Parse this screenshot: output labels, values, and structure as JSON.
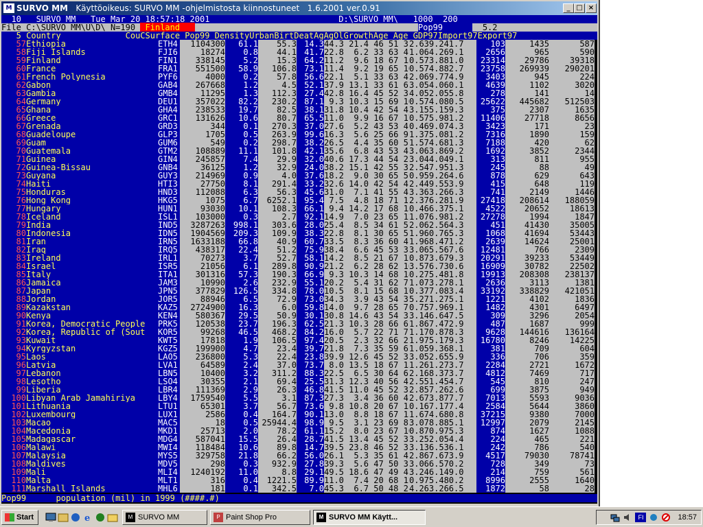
{
  "window": {
    "title": "SURVO MM",
    "title_rest": "   Käyttöoikeus: SURVO MM -ohjelmistosta kiinnostuneet   1.6.2001 ver.0.91",
    "minimize_label": "_",
    "maximize_label": "□",
    "close_label": "×"
  },
  "console": {
    "line0": "  10   SURVO MM   Tue Mar 20 18:57:18 2001                          D:\\SURVO_MM\\   1000  200",
    "line1_pre": "File C:\\SURVO_MM\\U\\D\\ N=190 ",
    "line1_hl": " Finland   ",
    "line1_mid": "                                             ",
    "line1_hl2": "Pop99      ",
    "line1_val": "  5.2    ",
    "header": "   5 Country             CouCSurface Pop99 DensityUrbanBirtDeatAgAgOlGrowthAge_Age_GDP97Import97Export97",
    "status_line": "Pop99      population (mil) in 1999 (####.#)"
  },
  "rows": [
    {
      "n": "57",
      "name": "Ethiopia",
      "code": "ETH4",
      "sur": "1104300",
      "pop": "61.1",
      "den": "55.3",
      "urb": "14.3",
      "misc": "44.3 21.4 46 51 3",
      "grw": "2.639.241.7",
      "gdp": "103",
      "imp": "1435",
      "exp": "587"
    },
    {
      "n": "58",
      "name": "Fiji Islands",
      "code": "FJI6",
      "sur": "18274",
      "pop": "0.8",
      "den": "44.1",
      "urb": "41.7",
      "misc": "22.8  6.2 33 63 4",
      "grw": "1.064.269.1",
      "gdp": "2656",
      "imp": "965",
      "exp": "590"
    },
    {
      "n": "59",
      "name": "Finland",
      "code": "FIN1",
      "sur": "338145",
      "pop": "5.2",
      "den": "15.3",
      "urb": "64.2",
      "misc": "11.2  9.6 18 67 15",
      "grw": "0.573.881.0",
      "gdp": "23314",
      "imp": "29786",
      "exp": "39318"
    },
    {
      "n": "60",
      "name": "France",
      "code": "FRA1",
      "sur": "551500",
      "pop": "58.9",
      "den": "106.8",
      "urb": "73.1",
      "misc": "11.4  9.2 19 65 16",
      "grw": "0.574.882.7",
      "gdp": "23758",
      "imp": "269939",
      "exp": "290201"
    },
    {
      "n": "61",
      "name": "French Polynesia",
      "code": "PYF6",
      "sur": "4000",
      "pop": "0.2",
      "den": "57.8",
      "urb": "56.6",
      "misc": "22.1  5.1 33 63 4",
      "grw": "2.069.774.9",
      "gdp": "3403",
      "imp": "945",
      "exp": "224"
    },
    {
      "n": "62",
      "name": "Gabon",
      "code": "GAB4",
      "sur": "267668",
      "pop": "1.2",
      "den": "4.5",
      "urb": "52.1",
      "misc": "37.9 13.1 33 61 6",
      "grw": "3.054.060.1",
      "gdp": "4639",
      "imp": "1102",
      "exp": "3020"
    },
    {
      "n": "63",
      "name": "Gambia",
      "code": "GMB4",
      "sur": "11295",
      "pop": "1.3",
      "den": "112.3",
      "urb": "27.4",
      "misc": "42.8 16.4 45 52 3",
      "grw": "4.052.055.8",
      "gdp": "278",
      "imp": "141",
      "exp": "14"
    },
    {
      "n": "64",
      "name": "Germany",
      "code": "DEU1",
      "sur": "357022",
      "pop": "82.2",
      "den": "230.2",
      "urb": "87.1",
      "misc": " 9.3 10.3 15 69 16",
      "grw": "0.574.080.5",
      "gdp": "25622",
      "imp": "445682",
      "exp": "512503"
    },
    {
      "n": "65",
      "name": "Ghana",
      "code": "GHA4",
      "sur": "238533",
      "pop": "19.7",
      "den": "82.5",
      "urb": "38.1",
      "misc": "31.8 10.4 42 54 4",
      "grw": "3.155.159.3",
      "gdp": "375",
      "imp": "2307",
      "exp": "1635"
    },
    {
      "n": "66",
      "name": "Greece",
      "code": "GRC1",
      "sur": "131626",
      "pop": "10.6",
      "den": "80.7",
      "urb": "65.5",
      "misc": "11.0  9.9 16 67 17",
      "grw": "0.575.981.2",
      "gdp": "11406",
      "imp": "27718",
      "exp": "8656"
    },
    {
      "n": "67",
      "name": "Grenada",
      "code": "GRD3",
      "sur": "344",
      "pop": "0.1",
      "den": "270.3",
      "urb": "37.0",
      "misc": "27.6  5.2 43 53 4",
      "grw": "0.469.074.3",
      "gdp": "3423",
      "imp": "171",
      "exp": "23"
    },
    {
      "n": "68",
      "name": "Guadeloupe",
      "code": "GLP3",
      "sur": "1705",
      "pop": "0.5",
      "den": "263.9",
      "urb": "99.6",
      "misc": "16.3  5.6 25 66 9",
      "grw": "1.375.081.2",
      "gdp": "7316",
      "imp": "1890",
      "exp": "159"
    },
    {
      "n": "69",
      "name": "Guam",
      "code": "GUM6",
      "sur": "549",
      "pop": "0.2",
      "den": "298.7",
      "urb": "38.2",
      "misc": "26.5  4.4 35 60 5",
      "grw": "1.574.681.3",
      "gdp": "7188",
      "imp": "420",
      "exp": "62"
    },
    {
      "n": "70",
      "name": "Guatemala",
      "code": "GTM2",
      "sur": "108889",
      "pop": "11.1",
      "den": "101.8",
      "urb": "42.1",
      "misc": "35.6  6.8 43 53 4",
      "grw": "3.063.869.2",
      "gdp": "1692",
      "imp": "3852",
      "exp": "2344"
    },
    {
      "n": "71",
      "name": "Guinea",
      "code": "GIN4",
      "sur": "245857",
      "pop": "7.4",
      "den": "29.9",
      "urb": "32.0",
      "misc": "40.6 17.3 44 54 2",
      "grw": "3.044.049.1",
      "gdp": "313",
      "imp": "811",
      "exp": "955"
    },
    {
      "n": "72",
      "name": "Guinea-Bissau",
      "code": "GNB4",
      "sur": "36125",
      "pop": "1.2",
      "den": "32.9",
      "urb": "24.0",
      "misc": "38.2 15.1 42 55 3",
      "grw": "2.547.951.3",
      "gdp": "245",
      "imp": "88",
      "exp": "49"
    },
    {
      "n": "73",
      "name": "Guyana",
      "code": "GUY3",
      "sur": "214969",
      "pop": "0.9",
      "den": "4.0",
      "urb": "37.6",
      "misc": "18.2  9.0 30 65 5",
      "grw": "0.959.264.6",
      "gdp": "878",
      "imp": "629",
      "exp": "643"
    },
    {
      "n": "74",
      "name": "Haiti",
      "code": "HTI3",
      "sur": "27750",
      "pop": "8.1",
      "den": "291.4",
      "urb": "33.2",
      "misc": "32.6 14.0 42 54 4",
      "grw": "2.449.553.9",
      "gdp": "415",
      "imp": "648",
      "exp": "119"
    },
    {
      "n": "75",
      "name": "Honduras",
      "code": "HND3",
      "sur": "112088",
      "pop": "6.3",
      "den": "56.3",
      "urb": "45.6",
      "misc": "31.0  7.1 41 55 4",
      "grw": "3.363.266.3",
      "gdp": "741",
      "imp": "2149",
      "exp": "1446"
    },
    {
      "n": "76",
      "name": "Hong Kong",
      "code": "HKG5",
      "sur": "1075",
      "pop": "6.7",
      "den": "6252.1",
      "urb": "95.4",
      "misc": " 7.5  4.8 18 71 11",
      "grw": "2.376.281.9",
      "gdp": "27418",
      "imp": "208614",
      "exp": "188059"
    },
    {
      "n": "77",
      "name": "Hungary",
      "code": "HUN1",
      "sur": "93030",
      "pop": "10.1",
      "den": "108.3",
      "urb": "66.1",
      "misc": " 9.4 14.2 17 68 15",
      "grw": "0.466.375.1",
      "gdp": "4522",
      "imp": "20652",
      "exp": "18613"
    },
    {
      "n": "78",
      "name": "Iceland",
      "code": "ISL1",
      "sur": "103000",
      "pop": "0.3",
      "den": "2.7",
      "urb": "92.1",
      "misc": "14.9  7.0 23 65 12",
      "grw": "1.076.981.2",
      "gdp": "27278",
      "imp": "1994",
      "exp": "1847"
    },
    {
      "n": "79",
      "name": "India",
      "code": "IND5",
      "sur": "3287263",
      "pop": "998.1",
      "den": "303.6",
      "urb": "28.0",
      "misc": "25.4  8.5 34 61 5",
      "grw": "2.062.564.3",
      "gdp": "451",
      "imp": "41430",
      "exp": "35005"
    },
    {
      "n": "80",
      "name": "Indonesia",
      "code": "IDN5",
      "sur": "1904569",
      "pop": "209.3",
      "den": "109.9",
      "urb": "38.3",
      "misc": "22.8  8.1 30 65 5",
      "grw": "1.960.765.3",
      "gdp": "1068",
      "imp": "41694",
      "exp": "53443"
    },
    {
      "n": "81",
      "name": "Iran",
      "code": "IRN5",
      "sur": "1633188",
      "pop": "66.8",
      "den": "40.9",
      "urb": "60.7",
      "misc": "33.5  8.3 36 60 4",
      "grw": "1.968.471.2",
      "gdp": "2639",
      "imp": "14624",
      "exp": "25001"
    },
    {
      "n": "82",
      "name": "Iraq",
      "code": "IRQ5",
      "sur": "438317",
      "pop": "22.4",
      "den": "51.2",
      "urb": "75.9",
      "misc": "38.4  6.6 45 53 3",
      "grw": "3.065.567.6",
      "gdp": "12481",
      "imp": "766",
      "exp": "2309"
    },
    {
      "n": "83",
      "name": "Ireland",
      "code": "IRL1",
      "sur": "70273",
      "pop": "3.7",
      "den": "52.7",
      "urb": "58.1",
      "misc": "14.2  8.5 21 67 12",
      "grw": "0.873.679.3",
      "gdp": "20291",
      "imp": "39233",
      "exp": "53449"
    },
    {
      "n": "84",
      "name": "Israel",
      "code": "ISR5",
      "sur": "21056",
      "pop": "6.1",
      "den": "289.8",
      "urb": "90.9",
      "misc": "21.2  6.2 28 62 10",
      "grw": "3.576.730.6",
      "gdp": "16909",
      "imp": "30782",
      "exp": "22502"
    },
    {
      "n": "85",
      "name": "Italy",
      "code": "ITA1",
      "sur": "301316",
      "pop": "57.3",
      "den": "190.3",
      "urb": "66.9",
      "misc": " 9.3 10.3 14 68 18",
      "grw": "0.275.481.8",
      "gdp": "19913",
      "imp": "208308",
      "exp": "238137"
    },
    {
      "n": "86",
      "name": "Jamaica",
      "code": "JAM3",
      "sur": "10990",
      "pop": "2.6",
      "den": "232.9",
      "urb": "55.1",
      "misc": "20.2  5.4 31 62 7",
      "grw": "1.073.278.1",
      "gdp": "2636",
      "imp": "3113",
      "exp": "1381"
    },
    {
      "n": "87",
      "name": "Japan",
      "code": "JPN5",
      "sur": "377829",
      "pop": "126.5",
      "den": "334.8",
      "urb": "78.0",
      "misc": "10.5  8.1 15 68 17",
      "grw": "0.377.083.4",
      "gdp": "33192",
      "imp": "338829",
      "exp": "421051"
    },
    {
      "n": "88",
      "name": "Jordan",
      "code": "JOR5",
      "sur": "88946",
      "pop": "6.5",
      "den": "72.9",
      "urb": "73.0",
      "misc": "34.3  3.9 43 54 3",
      "grw": "5.271.275.1",
      "gdp": "1221",
      "imp": "4102",
      "exp": "1836"
    },
    {
      "n": "89",
      "name": "Kazakstan",
      "code": "KAZ5",
      "sur": "2724900",
      "pop": "16.3",
      "den": "6.0",
      "urb": "59.8",
      "misc": "14.0  9.7 28 65 7",
      "grw": "0.757.969.1",
      "gdp": "1482",
      "imp": "4301",
      "exp": "6497"
    },
    {
      "n": "90",
      "name": "Kenya",
      "code": "KEN4",
      "sur": "580367",
      "pop": "29.5",
      "den": "50.9",
      "urb": "30.1",
      "misc": "30.8 14.6 43 54 3",
      "grw": "3.146.647.5",
      "gdp": "309",
      "imp": "3296",
      "exp": "2054"
    },
    {
      "n": "91",
      "name": "Korea, Democratic People",
      "code": "PRK5",
      "sur": "120538",
      "pop": "23.7",
      "den": "196.3",
      "urb": "62.5",
      "misc": "21.3 10.3 28 66 6",
      "grw": "1.867.472.9",
      "gdp": "487",
      "imp": "1687",
      "exp": "999"
    },
    {
      "n": "92",
      "name": "Korea, Republic of (Sout",
      "code": "KOR5",
      "sur": "99268",
      "pop": "46.5",
      "den": "468.2",
      "urb": "84.2",
      "misc": "16.0  5.7 22 71 7",
      "grw": "1.170.878.3",
      "gdp": "9628",
      "imp": "144616",
      "exp": "136164"
    },
    {
      "n": "93",
      "name": "Kuwait",
      "code": "KWT5",
      "sur": "17818",
      "pop": "1.9",
      "den": "106.5",
      "urb": "97.4",
      "misc": "20.5  2.3 32 66 2",
      "grw": "1.975.179.3",
      "gdp": "16780",
      "imp": "8246",
      "exp": "14225"
    },
    {
      "n": "94",
      "name": "Kyrgyzstan",
      "code": "KGZ5",
      "sur": "199900",
      "pop": "4.7",
      "den": "23.4",
      "urb": "39.7",
      "misc": "21.8  7.3 35 59 6",
      "grw": "1.059.368.1",
      "gdp": "381",
      "imp": "709",
      "exp": "604"
    },
    {
      "n": "95",
      "name": "Laos",
      "code": "LAO5",
      "sur": "236800",
      "pop": "5.3",
      "den": "22.4",
      "urb": "23.8",
      "misc": "39.9 12.6 45 52 3",
      "grw": "3.052.655.9",
      "gdp": "336",
      "imp": "706",
      "exp": "359"
    },
    {
      "n": "96",
      "name": "Latvia",
      "code": "LVA1",
      "sur": "64589",
      "pop": "2.4",
      "den": "37.0",
      "urb": "73.7",
      "misc": " 8.0 13.5 18 67 15",
      "grw": "1.261.273.7",
      "gdp": "2284",
      "imp": "2721",
      "exp": "1672"
    },
    {
      "n": "97",
      "name": "Lebanon",
      "code": "LBN5",
      "sur": "10400",
      "pop": "3.2",
      "den": "311.2",
      "urb": "88.3",
      "misc": "22.5  6.5 30 64 6",
      "grw": "2.168.373.7",
      "gdp": "4812",
      "imp": "7469",
      "exp": "717"
    },
    {
      "n": "98",
      "name": "Lesotho",
      "code": "LSO4",
      "sur": "30355",
      "pop": "2.1",
      "den": "69.4",
      "urb": "25.5",
      "misc": "31.3 12.3 40 56 4",
      "grw": "2.551.454.7",
      "gdp": "545",
      "imp": "810",
      "exp": "247"
    },
    {
      "n": "99",
      "name": "Liberia",
      "code": "LBR4",
      "sur": "111369",
      "pop": "2.9",
      "den": "26.3",
      "urb": "46.8",
      "misc": "41.5 11.0 45 52 3",
      "grw": "2.857.262.6",
      "gdp": "699",
      "imp": "3875",
      "exp": "949"
    },
    {
      "n": "100",
      "name": "Libyan Arab Jamahiriya",
      "code": "LBY4",
      "sur": "1759540",
      "pop": "5.5",
      "den": "3.1",
      "urb": "87.3",
      "misc": "27.3  3.4 36 60 4",
      "grw": "2.673.877.7",
      "gdp": "7013",
      "imp": "5593",
      "exp": "9036"
    },
    {
      "n": "101",
      "name": "Lithuania",
      "code": "LTU1",
      "sur": "65301",
      "pop": "3.7",
      "den": "56.7",
      "urb": "73.6",
      "misc": " 9.8 10.8 20 67 13",
      "grw": "0.167.177.4",
      "gdp": "2584",
      "imp": "5644",
      "exp": "3860"
    },
    {
      "n": "102",
      "name": "Luxembourg",
      "code": "LUX1",
      "sur": "2586",
      "pop": "0.4",
      "den": "164.7",
      "urb": "90.1",
      "misc": "13.0  8.8 18 67 15",
      "grw": "1.674.680.8",
      "gdp": "37215",
      "imp": "9380",
      "exp": "7000"
    },
    {
      "n": "103",
      "name": "Macao",
      "code": "MAC5",
      "sur": "18",
      "pop": "0.5",
      "den": "25944.4",
      "urb": "98.9",
      "misc": " 9.5  3.1 23 69 8",
      "grw": "3.078.885.1",
      "gdp": "12997",
      "imp": "2079",
      "exp": "2145"
    },
    {
      "n": "104",
      "name": "Macedonia",
      "code": "MKD1",
      "sur": "25713",
      "pop": "2.0",
      "den": "78.2",
      "urb": "61.1",
      "misc": "15.2  8.0 23 67 10",
      "grw": "0.870.975.3",
      "gdp": "874",
      "imp": "1627",
      "exp": "1088"
    },
    {
      "n": "105",
      "name": "Madagascar",
      "code": "MDG4",
      "sur": "587041",
      "pop": "15.5",
      "den": "26.4",
      "urb": "28.7",
      "misc": "41.5 13.4 45 52 3",
      "grw": "3.252.054.4",
      "gdp": "224",
      "imp": "465",
      "exp": "221"
    },
    {
      "n": "106",
      "name": "Malawi",
      "code": "MWI4",
      "sur": "118484",
      "pop": "10.6",
      "den": "89.8",
      "urb": "14.7",
      "misc": "39.5 23.8 46 52 3",
      "grw": "3.136.536.1",
      "gdp": "242",
      "imp": "786",
      "exp": "540"
    },
    {
      "n": "107",
      "name": "Malaysia",
      "code": "MYS5",
      "sur": "329758",
      "pop": "21.8",
      "den": "66.2",
      "urb": "56.0",
      "misc": "26.1  5.3 35 61 4",
      "grw": "2.867.673.9",
      "gdp": "4517",
      "imp": "79030",
      "exp": "78741"
    },
    {
      "n": "108",
      "name": "Maldives",
      "code": "MDV5",
      "sur": "298",
      "pop": "0.3",
      "den": "932.9",
      "urb": "27.8",
      "misc": "39.3  5.6 47 50 3",
      "grw": "3.066.570.2",
      "gdp": "728",
      "imp": "349",
      "exp": "73"
    },
    {
      "n": "109",
      "name": "Mali",
      "code": "MLI4",
      "sur": "1240192",
      "pop": "11.0",
      "den": "8.8",
      "urb": "29.1",
      "misc": "49.5 18.6 47 49 4",
      "grw": "3.246.149.0",
      "gdp": "214",
      "imp": "759",
      "exp": "561"
    },
    {
      "n": "110",
      "name": "Malta",
      "code": "MLT1",
      "sur": "316",
      "pop": "0.4",
      "den": "1221.5",
      "urb": "89.9",
      "misc": "11.0  7.4 20 68 12",
      "grw": "0.975.480.2",
      "gdp": "8996",
      "imp": "2555",
      "exp": "1640"
    },
    {
      "n": "111",
      "name": "Marshall Islands",
      "code": "MHL6",
      "sur": "181",
      "pop": "0.1",
      "den": "342.5",
      "urb": "7.0",
      "misc": "45.3  6.7 50 48 2",
      "grw": "4.263.266.5",
      "gdp": "1872",
      "imp": "58",
      "exp": "28"
    }
  ],
  "taskbar": {
    "start_label": "Start",
    "task1_label": "SURVO MM",
    "task2_label": "Paint Shop Pro",
    "task3_label": "SURVO MM       Käytt...",
    "clock": "18:57",
    "lang": "FI"
  },
  "colors": {
    "console_blue": "#0000a8",
    "console_gray": "#c0c0c0",
    "title_blue": "#0a246a",
    "highlight_red": "#ff0000"
  }
}
